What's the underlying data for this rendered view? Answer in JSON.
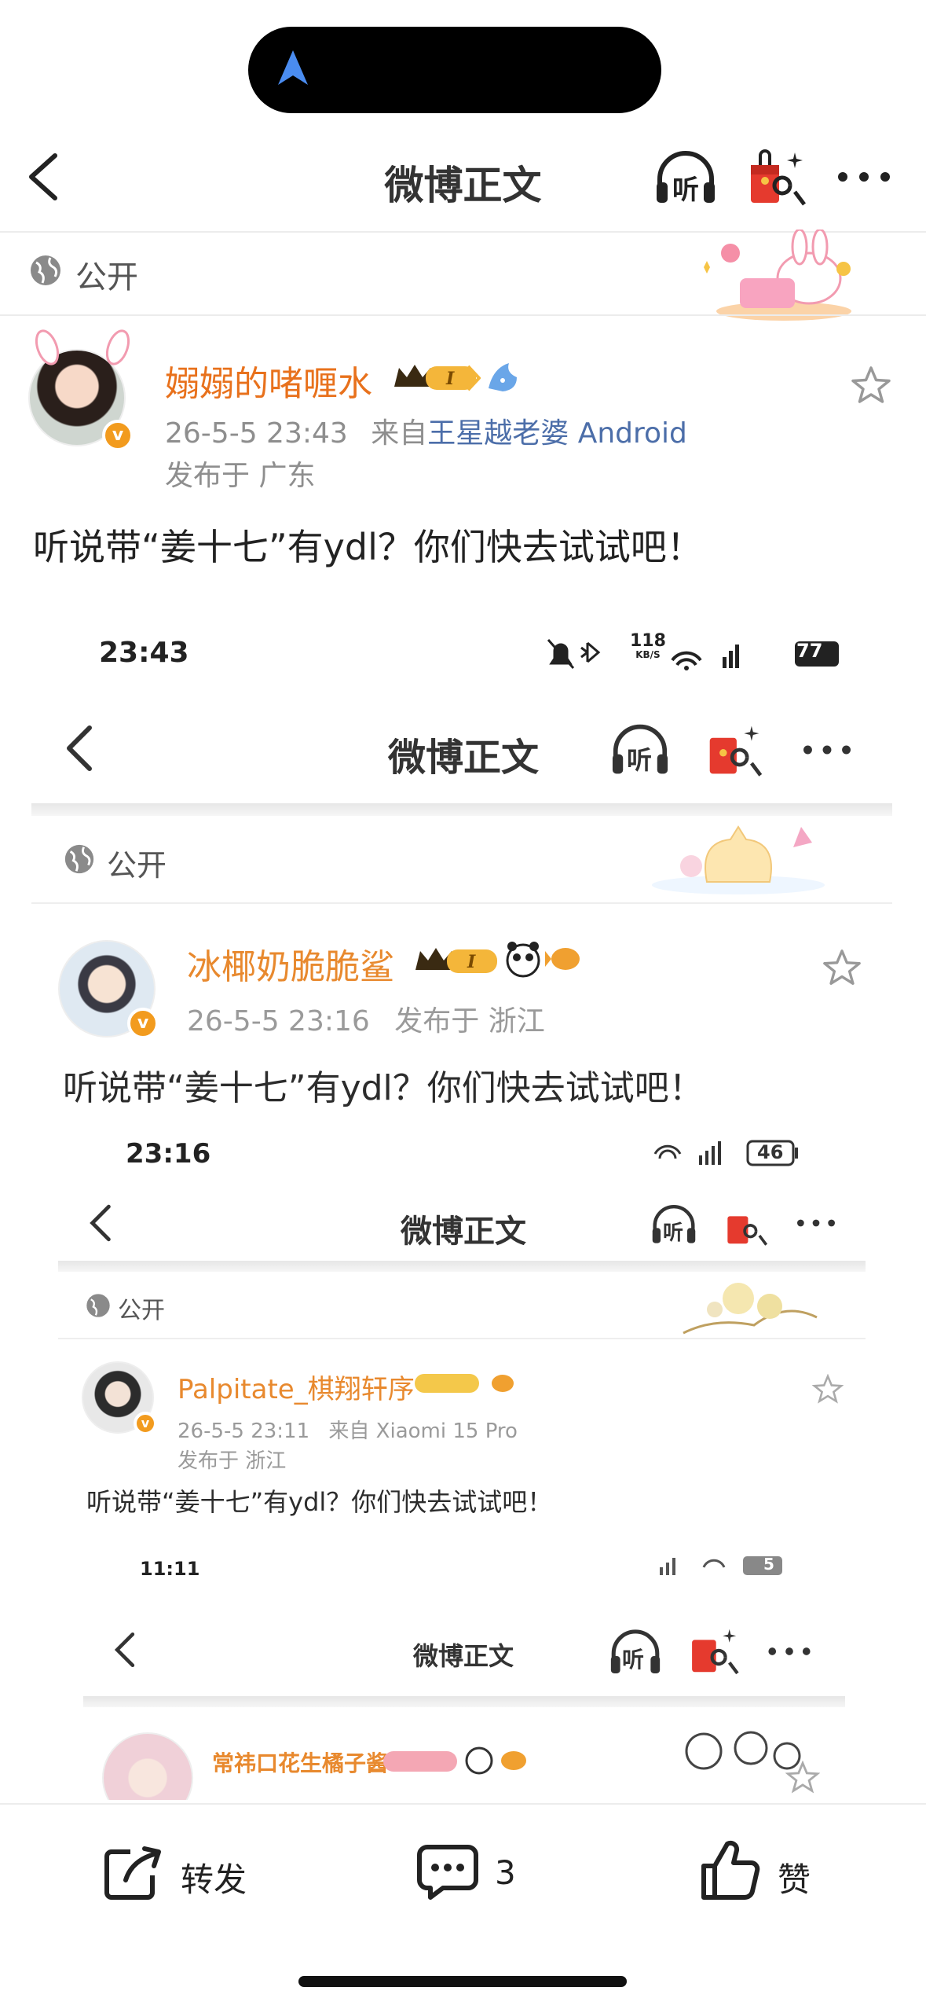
{
  "header": {
    "title": "微博正文",
    "listen_label": "听"
  },
  "visibility": {
    "label": "公开"
  },
  "post": {
    "username": "嫋嫋的啫喱水",
    "level_badge": "I",
    "time": "26-5-5 23:43",
    "source_prefix": "来自",
    "source": "王星越老婆 Android",
    "location": "发布于 广东",
    "text": "听说带“姜十七”有ydl？你们快去试试吧！"
  },
  "embed1": {
    "status_time": "23:43",
    "net_speed": "118",
    "net_unit": "KB/S",
    "battery": "77",
    "title": "微博正文",
    "listen_label": "听",
    "visibility": "公开",
    "username": "冰椰奶脆脆鲨",
    "level_badge": "I",
    "time": "26-5-5 23:16",
    "location": "发布于 浙江",
    "text": "听说带“姜十七”有ydl？你们快去试试吧！"
  },
  "embed2": {
    "status_time": "23:16",
    "battery": "46",
    "title": "微博正文",
    "listen_label": "听",
    "visibility": "公开",
    "username": "Palpitate_棋翔轩序",
    "time": "26-5-5 23:11",
    "source": "来自 Xiaomi 15 Pro",
    "location": "发布于 浙江",
    "text": "听说带“姜十七”有ydl？你们快去试试吧！"
  },
  "embed3": {
    "status_time": "11:11",
    "battery": "5",
    "title": "微博正文",
    "listen_label": "听",
    "username": "常祎口花生橘子酱"
  },
  "actions": {
    "repost_label": "转发",
    "comment_count": "3",
    "like_label": "赞"
  },
  "colors": {
    "username": "#e8711c",
    "source_link": "#4c6ea9",
    "badge": "#f29b1e"
  }
}
